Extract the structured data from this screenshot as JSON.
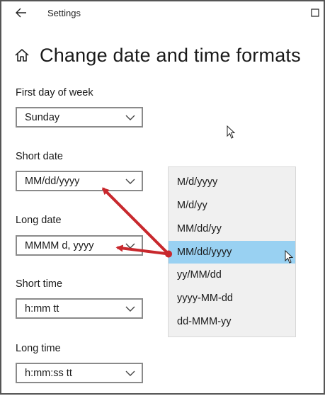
{
  "window": {
    "title": "Settings"
  },
  "page": {
    "title": "Change date and time formats"
  },
  "fields": {
    "first_day": {
      "label": "First day of week",
      "value": "Sunday"
    },
    "short_date": {
      "label": "Short date",
      "value": "MM/dd/yyyy"
    },
    "long_date": {
      "label": "Long date",
      "value": "MMMM d, yyyy"
    },
    "short_time": {
      "label": "Short time",
      "value": "h:mm tt"
    },
    "long_time": {
      "label": "Long time",
      "value": "h:mm:ss tt"
    }
  },
  "dropdown": {
    "options": [
      "M/d/yyyy",
      "M/d/yy",
      "MM/dd/yy",
      "MM/dd/yyyy",
      "yy/MM/dd",
      "yyyy-MM-dd",
      "dd-MMM-yy"
    ],
    "selected": "MM/dd/yyyy"
  },
  "colors": {
    "selection": "#99d1f2",
    "annotation_arrow": "#c8282d",
    "dropdown_bg": "#f0f0f0"
  },
  "icons": [
    "back-arrow-icon",
    "maximize-icon",
    "home-icon",
    "chevron-down-icon",
    "mouse-pointer-icon"
  ]
}
